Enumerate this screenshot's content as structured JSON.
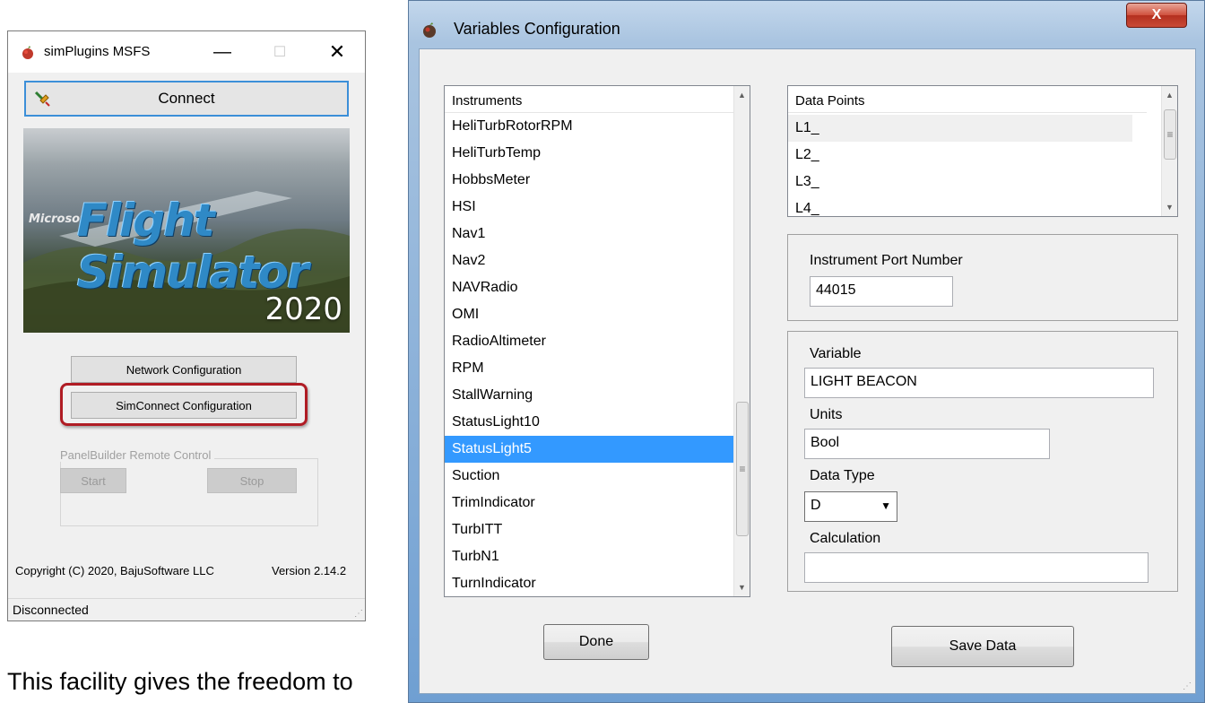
{
  "left_window": {
    "title": "simPlugins MSFS",
    "connect_label": "Connect",
    "splash": {
      "microsoft": "Microsoft",
      "flight_simulator": "Flight Simulator",
      "year": "2020"
    },
    "network_config_label": "Network Configuration",
    "simconnect_config_label": "SimConnect Configuration",
    "panelbuilder_group_label": "PanelBuilder Remote Control",
    "start_label": "Start",
    "stop_label": "Stop",
    "copyright": "Copyright (C) 2020, BajuSoftware LLC",
    "version": "Version 2.14.2",
    "status": "Disconnected"
  },
  "right_window": {
    "title": "Variables Configuration",
    "close_glyph": "X",
    "instruments": {
      "header": "Instruments",
      "items": [
        "HeliTurbRotorRPM",
        "HeliTurbTemp",
        "HobbsMeter",
        "HSI",
        "Nav1",
        "Nav2",
        "NAVRadio",
        "OMI",
        "RadioAltimeter",
        "RPM",
        "StallWarning",
        "StatusLight10",
        "StatusLight5",
        "Suction",
        "TrimIndicator",
        "TurbITT",
        "TurbN1",
        "TurnIndicator"
      ],
      "selected": "StatusLight5"
    },
    "data_points": {
      "header": "Data Points",
      "items": [
        "L1_",
        "L2_",
        "L3_",
        "L4_"
      ]
    },
    "port": {
      "label": "Instrument Port Number",
      "value": "44015"
    },
    "variable": {
      "label": "Variable",
      "value": "LIGHT BEACON"
    },
    "units": {
      "label": "Units",
      "value": "Bool"
    },
    "data_type": {
      "label": "Data Type",
      "value": "D"
    },
    "calculation": {
      "label": "Calculation",
      "value": ""
    },
    "done_label": "Done",
    "save_label": "Save Data"
  },
  "background_caption": "This facility gives the freedom to"
}
